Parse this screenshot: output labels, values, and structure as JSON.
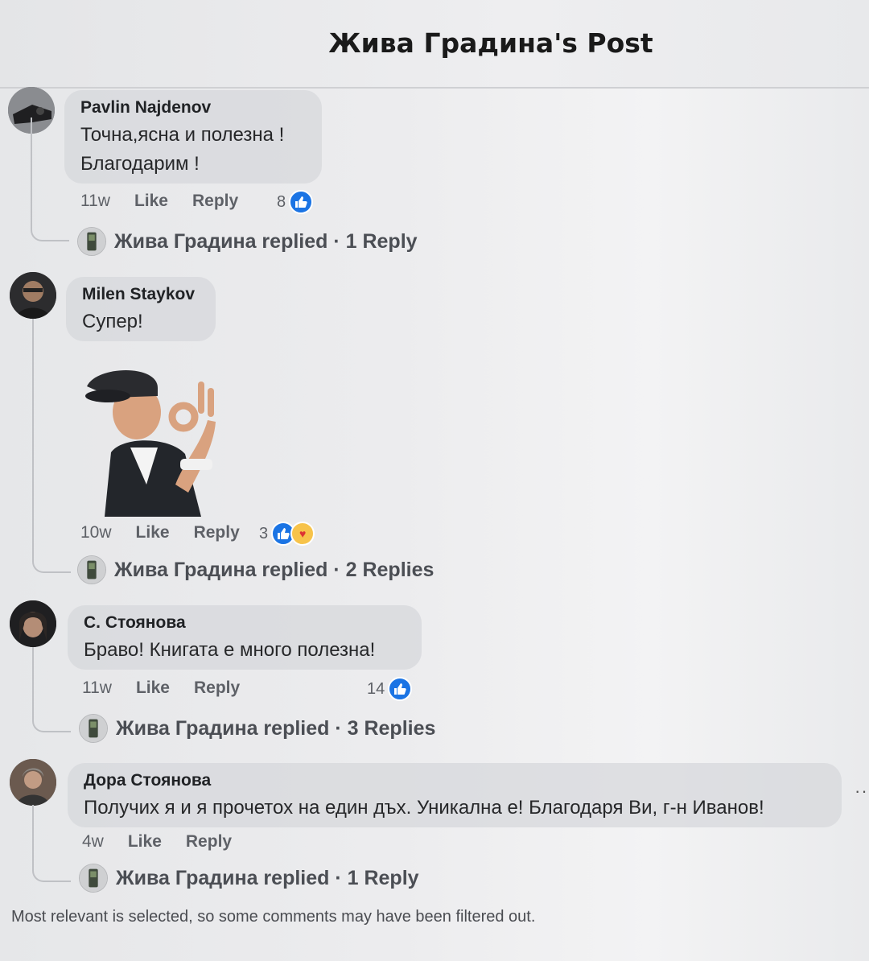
{
  "header": {
    "title": "Жива Градина's Post"
  },
  "comments": [
    {
      "author": "Pavlin Najdenov",
      "text": "Точна,ясна и полезна !\nБлагодарим !",
      "time": "11w",
      "like_label": "Like",
      "reply_label": "Reply",
      "reaction_count": "8",
      "replied_text": "Жива Градина replied · 1 Reply"
    },
    {
      "author": "Milen Staykov",
      "text": "Супер!",
      "time": "10w",
      "like_label": "Like",
      "reply_label": "Reply",
      "reaction_count": "3",
      "replied_text": "Жива Градина replied · 2 Replies"
    },
    {
      "author": "С. Стоянова",
      "text": "Браво! Книгата е много полезна!",
      "time": "11w",
      "like_label": "Like",
      "reply_label": "Reply",
      "reaction_count": "14",
      "replied_text": "Жива Градина replied · 3 Replies"
    },
    {
      "author": "Дора Стоянова",
      "text": "Получих я и я прочетох на един дъх. Уникална е! Благодаря Ви, г-н Иванов!",
      "time": "4w",
      "like_label": "Like",
      "reply_label": "Reply",
      "replied_text": "Жива Градина replied · 1 Reply"
    }
  ],
  "footer": {
    "note": "Most relevant is selected, so some comments may have been filtered out."
  },
  "colors": {
    "like_blue": "#1b74e4",
    "bubble": "#d6d7db",
    "background": "#ececee"
  },
  "icons": [
    "like-icon",
    "care-icon",
    "more-options-icon",
    "avatar"
  ]
}
